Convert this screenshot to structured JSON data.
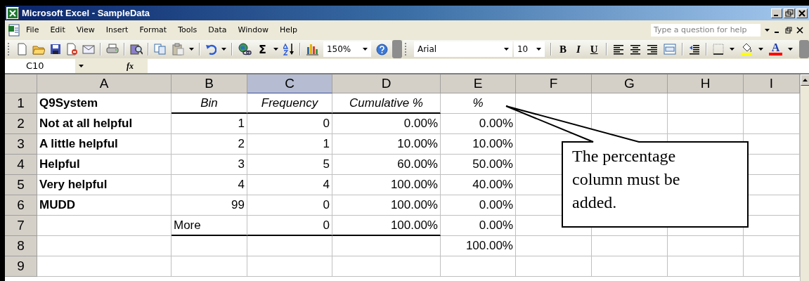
{
  "window": {
    "title": "Microsoft Excel - SampleData"
  },
  "menu": [
    {
      "label": "File"
    },
    {
      "label": "Edit"
    },
    {
      "label": "View"
    },
    {
      "label": "Insert"
    },
    {
      "label": "Format"
    },
    {
      "label": "Tools"
    },
    {
      "label": "Data"
    },
    {
      "label": "Window"
    },
    {
      "label": "Help"
    }
  ],
  "help_box": {
    "placeholder": "Type a question for help"
  },
  "toolbar": {
    "sum": "Σ",
    "zoom": "150%",
    "font": "Arial",
    "font_size": "10",
    "bold": "B",
    "italic": "I",
    "underline": "U",
    "font_color": "A"
  },
  "formula_bar": {
    "name_box": "C10",
    "function_label": "fx"
  },
  "sheet": {
    "columns": [
      {
        "label": "A",
        "selected": false
      },
      {
        "label": "B",
        "selected": false
      },
      {
        "label": "C",
        "selected": true
      },
      {
        "label": "D",
        "selected": false
      },
      {
        "label": "E",
        "selected": false
      },
      {
        "label": "F",
        "selected": false
      },
      {
        "label": "G",
        "selected": false
      },
      {
        "label": "H",
        "selected": false
      },
      {
        "label": "I",
        "selected": false
      }
    ],
    "rows": [
      {
        "number": "1",
        "kind": "header",
        "rule_below": true,
        "cells": [
          "Q9System",
          "Bin",
          "Frequency",
          "Cumulative %",
          "%"
        ]
      },
      {
        "number": "2",
        "kind": "data",
        "rule_below": false,
        "cells": [
          "Not at all helpful",
          "1",
          "0",
          "0.00%",
          "0.00%"
        ]
      },
      {
        "number": "3",
        "kind": "data",
        "rule_below": false,
        "cells": [
          "A little helpful",
          "2",
          "1",
          "10.00%",
          "10.00%"
        ]
      },
      {
        "number": "4",
        "kind": "data",
        "rule_below": false,
        "cells": [
          "Helpful",
          "3",
          "5",
          "60.00%",
          "50.00%"
        ]
      },
      {
        "number": "5",
        "kind": "data",
        "rule_below": false,
        "cells": [
          "Very helpful",
          "4",
          "4",
          "100.00%",
          "40.00%"
        ]
      },
      {
        "number": "6",
        "kind": "data",
        "rule_below": false,
        "cells": [
          "MUDD",
          "99",
          "0",
          "100.00%",
          "0.00%"
        ]
      },
      {
        "number": "7",
        "kind": "data",
        "rule_below": true,
        "cells": [
          null,
          "More",
          "0",
          "100.00%",
          "0.00%"
        ]
      },
      {
        "number": "8",
        "kind": "data",
        "rule_below": false,
        "cells": [
          null,
          null,
          null,
          null,
          "100.00%"
        ]
      },
      {
        "number": "9",
        "kind": "data",
        "rule_below": false,
        "cells": []
      }
    ]
  },
  "callout": {
    "text": "The percentage column must be added."
  }
}
